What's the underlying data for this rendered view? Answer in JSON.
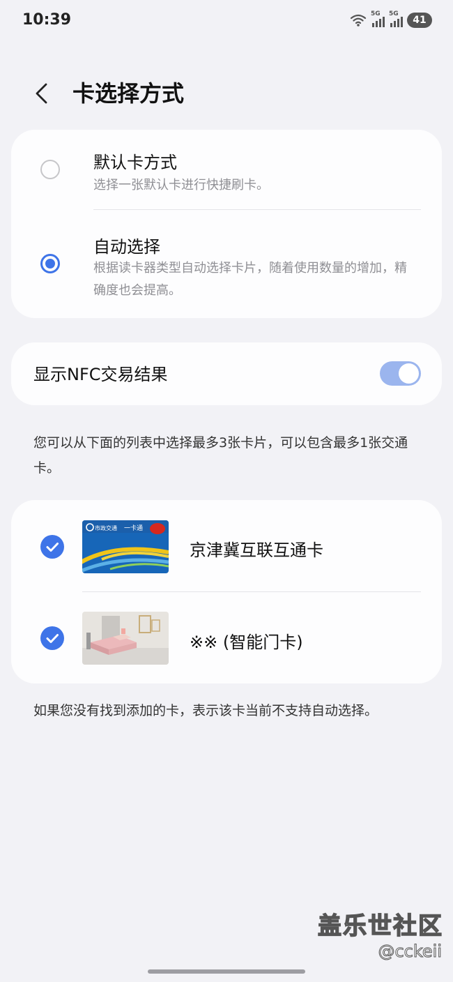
{
  "status_bar": {
    "time": "10:39",
    "signal1_label": "5G",
    "signal2_label": "5G",
    "battery": "41"
  },
  "header": {
    "title": "卡选择方式"
  },
  "selection_mode": {
    "options": [
      {
        "title": "默认卡方式",
        "description": "选择一张默认卡进行快捷刷卡。",
        "selected": false
      },
      {
        "title": "自动选择",
        "description": "根据读卡器类型自动选择卡片，随着使用数量的增加，精确度也会提高。",
        "selected": true
      }
    ]
  },
  "nfc_setting": {
    "label": "显示NFC交易结果",
    "enabled": true
  },
  "list_info": "您可以从下面的列表中选择最多3张卡片，可以包含最多1张交通卡。",
  "cards": [
    {
      "name": "京津冀互联互通卡",
      "checked": true,
      "thumb_text_left": "市政交通",
      "thumb_text_right": "一卡通"
    },
    {
      "name": "※※ (智能门卡)",
      "checked": true
    }
  ],
  "footer_info": "如果您没有找到添加的卡，表示该卡当前不支持自动选择。",
  "watermark": {
    "brand": "盖乐世社区",
    "user": "@cckeii"
  },
  "colors": {
    "accent": "#3e74e8",
    "background": "#f2f2f6",
    "card": "#fdfdfe",
    "toggle_track": "#9bb5ee"
  }
}
